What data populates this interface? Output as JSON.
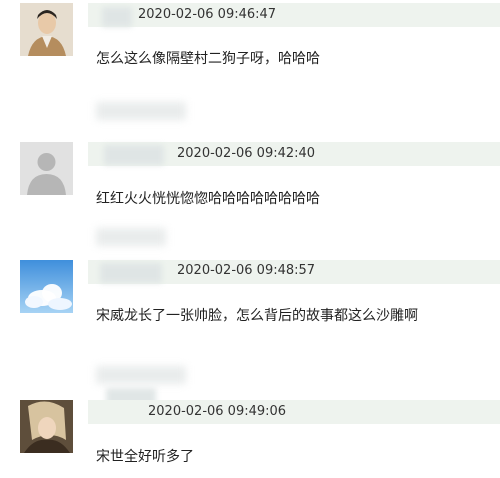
{
  "comments": [
    {
      "avatar_icon": "user-photo-avatar",
      "timestamp": "2020-02-06 09:46:47",
      "text": "怎么这么像隔壁村二狗子呀，哈哈哈"
    },
    {
      "avatar_icon": "default-user-avatar",
      "timestamp": "2020-02-06 09:42:40",
      "text": "红红火火恍恍惚惚哈哈哈哈哈哈哈哈"
    },
    {
      "avatar_icon": "sky-clouds-avatar",
      "timestamp": "2020-02-06 09:48:57",
      "text": "宋威龙长了一张帅脸，怎么背后的故事都这么沙雕啊"
    },
    {
      "avatar_icon": "user-photo-avatar",
      "timestamp": "2020-02-06 09:49:06",
      "text": "宋世全好听多了"
    }
  ]
}
